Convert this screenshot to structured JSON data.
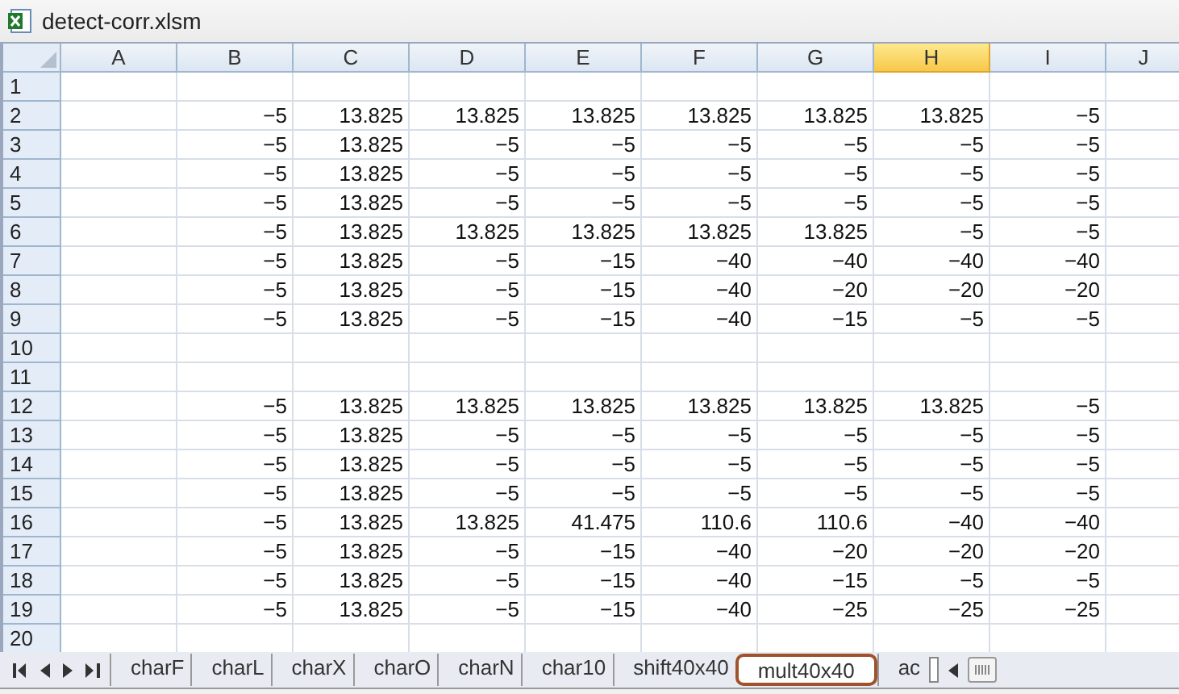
{
  "window": {
    "title": "detect-corr.xlsm"
  },
  "columns": [
    {
      "label": "A",
      "selected": false
    },
    {
      "label": "B",
      "selected": false
    },
    {
      "label": "C",
      "selected": false
    },
    {
      "label": "D",
      "selected": false
    },
    {
      "label": "E",
      "selected": false
    },
    {
      "label": "F",
      "selected": false
    },
    {
      "label": "G",
      "selected": false
    },
    {
      "label": "H",
      "selected": true
    },
    {
      "label": "I",
      "selected": false
    },
    {
      "label": "J",
      "selected": false
    }
  ],
  "rows": [
    {
      "number": "1",
      "cells": []
    },
    {
      "number": "2",
      "cells": [
        "",
        "−5",
        "13.825",
        "13.825",
        "13.825",
        "13.825",
        "13.825",
        "13.825",
        "−5"
      ]
    },
    {
      "number": "3",
      "cells": [
        "",
        "−5",
        "13.825",
        "−5",
        "−5",
        "−5",
        "−5",
        "−5",
        "−5"
      ]
    },
    {
      "number": "4",
      "cells": [
        "",
        "−5",
        "13.825",
        "−5",
        "−5",
        "−5",
        "−5",
        "−5",
        "−5"
      ]
    },
    {
      "number": "5",
      "cells": [
        "",
        "−5",
        "13.825",
        "−5",
        "−5",
        "−5",
        "−5",
        "−5",
        "−5"
      ]
    },
    {
      "number": "6",
      "cells": [
        "",
        "−5",
        "13.825",
        "13.825",
        "13.825",
        "13.825",
        "13.825",
        "−5",
        "−5"
      ]
    },
    {
      "number": "7",
      "cells": [
        "",
        "−5",
        "13.825",
        "−5",
        "−15",
        "−40",
        "−40",
        "−40",
        "−40"
      ]
    },
    {
      "number": "8",
      "cells": [
        "",
        "−5",
        "13.825",
        "−5",
        "−15",
        "−40",
        "−20",
        "−20",
        "−20"
      ]
    },
    {
      "number": "9",
      "cells": [
        "",
        "−5",
        "13.825",
        "−5",
        "−15",
        "−40",
        "−15",
        "−5",
        "−5"
      ]
    },
    {
      "number": "10",
      "cells": []
    },
    {
      "number": "11",
      "cells": []
    },
    {
      "number": "12",
      "cells": [
        "",
        "−5",
        "13.825",
        "13.825",
        "13.825",
        "13.825",
        "13.825",
        "13.825",
        "−5"
      ]
    },
    {
      "number": "13",
      "cells": [
        "",
        "−5",
        "13.825",
        "−5",
        "−5",
        "−5",
        "−5",
        "−5",
        "−5"
      ]
    },
    {
      "number": "14",
      "cells": [
        "",
        "−5",
        "13.825",
        "−5",
        "−5",
        "−5",
        "−5",
        "−5",
        "−5"
      ]
    },
    {
      "number": "15",
      "cells": [
        "",
        "−5",
        "13.825",
        "−5",
        "−5",
        "−5",
        "−5",
        "−5",
        "−5"
      ]
    },
    {
      "number": "16",
      "cells": [
        "",
        "−5",
        "13.825",
        "13.825",
        "41.475",
        "110.6",
        "110.6",
        "−40",
        "−40"
      ]
    },
    {
      "number": "17",
      "cells": [
        "",
        "−5",
        "13.825",
        "−5",
        "−15",
        "−40",
        "−20",
        "−20",
        "−20"
      ]
    },
    {
      "number": "18",
      "cells": [
        "",
        "−5",
        "13.825",
        "−5",
        "−15",
        "−40",
        "−15",
        "−5",
        "−5"
      ]
    },
    {
      "number": "19",
      "cells": [
        "",
        "−5",
        "13.825",
        "−5",
        "−15",
        "−40",
        "−25",
        "−25",
        "−25"
      ]
    },
    {
      "number": "20",
      "cells": []
    }
  ],
  "tabs": [
    {
      "label": "charF",
      "selected": false
    },
    {
      "label": "charL",
      "selected": false
    },
    {
      "label": "charX",
      "selected": false
    },
    {
      "label": "charO",
      "selected": false
    },
    {
      "label": "charN",
      "selected": false
    },
    {
      "label": "char10",
      "selected": false
    },
    {
      "label": "shift40x40",
      "selected": false
    },
    {
      "label": "mult40x40",
      "selected": true
    },
    {
      "label": "ac",
      "selected": false
    }
  ]
}
